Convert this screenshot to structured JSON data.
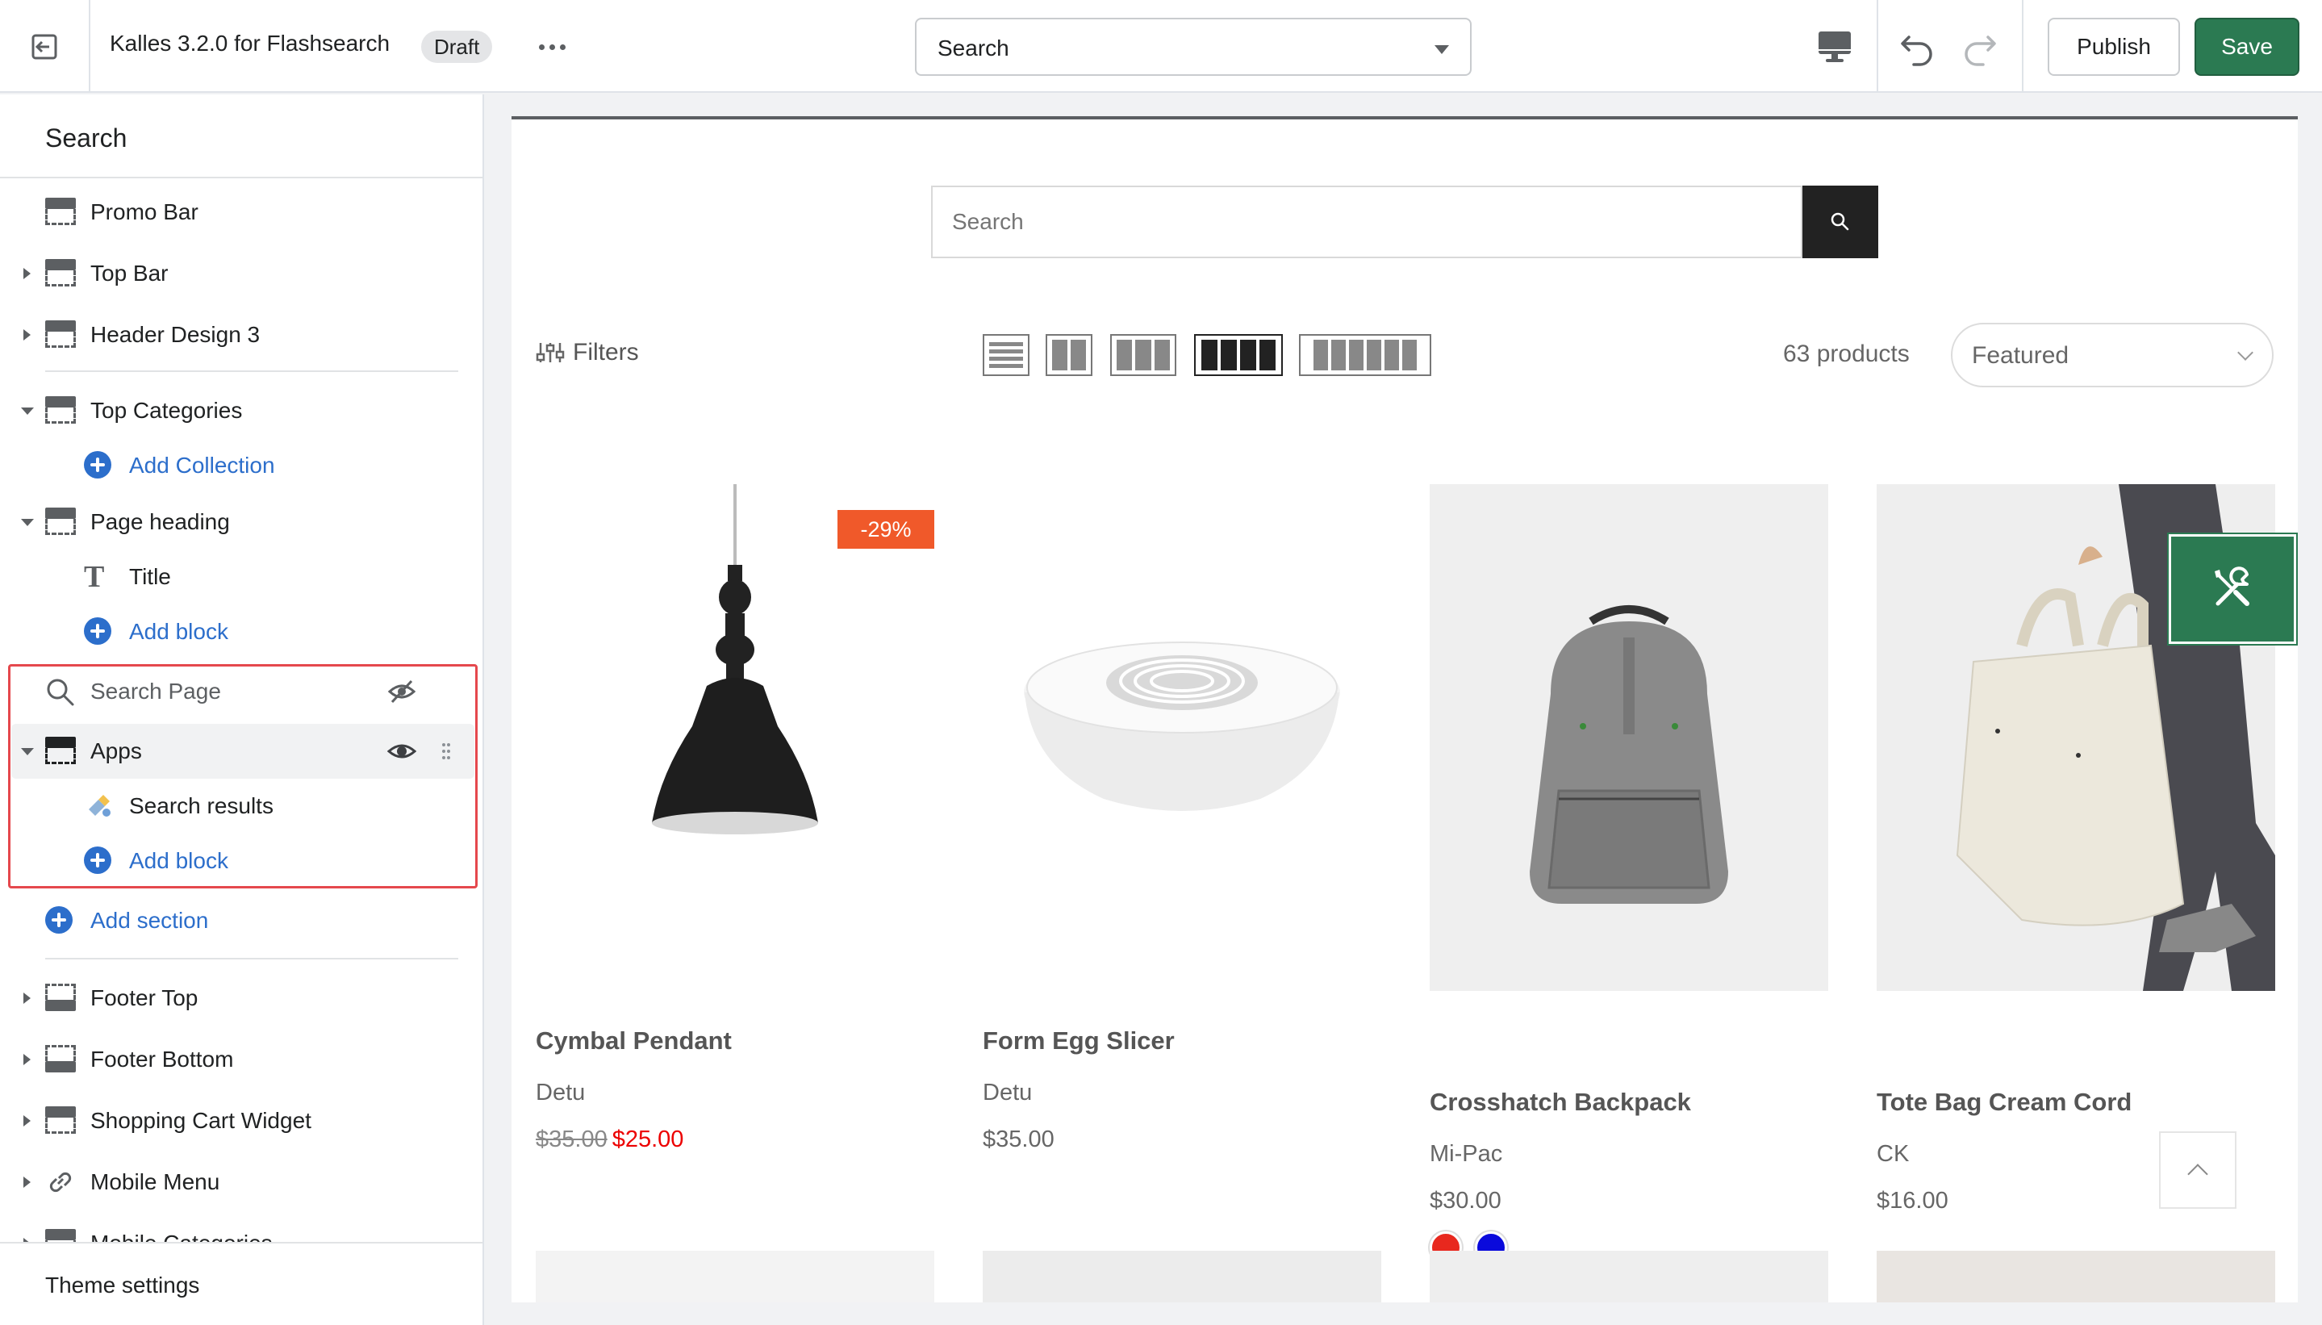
{
  "topbar": {
    "title": "Kalles 3.2.0 for Flashsearch",
    "badge": "Draft",
    "template_select": "Search",
    "publish_label": "Publish",
    "save_label": "Save"
  },
  "sidebar": {
    "header": "Search",
    "items": {
      "promo_bar": "Promo Bar",
      "top_bar": "Top Bar",
      "header_design": "Header Design 3",
      "top_categories": "Top Categories",
      "add_collection": "Add Collection",
      "page_heading": "Page heading",
      "title": "Title",
      "add_block_1": "Add block",
      "search_page": "Search Page",
      "apps": "Apps",
      "search_results": "Search results",
      "add_block_2": "Add block",
      "add_section": "Add section",
      "footer_top": "Footer Top",
      "footer_bottom": "Footer Bottom",
      "shopping_cart": "Shopping Cart Widget",
      "mobile_menu": "Mobile Menu",
      "mobile_categories": "Mobile Categories"
    },
    "footer": "Theme settings"
  },
  "preview": {
    "search_placeholder": "Search",
    "filters_label": "Filters",
    "product_count": "63 products",
    "sort_selected": "Featured",
    "products": [
      {
        "name": "Cymbal Pendant",
        "vendor": "Detu",
        "compare_price": "$35.00",
        "price": "$25.00",
        "badge": "-29%"
      },
      {
        "name": "Form Egg Slicer",
        "vendor": "Detu",
        "price": "$35.00"
      },
      {
        "name": "Crosshatch Backpack",
        "vendor": "Mi-Pac",
        "price": "$30.00",
        "swatches": [
          "#e8281e",
          "#0a0adc"
        ]
      },
      {
        "name": "Tote Bag Cream Cord",
        "vendor": "CK",
        "price": "$16.00"
      }
    ]
  },
  "colors": {
    "accent": "#2b7a52",
    "link": "#2c6ecb",
    "sale": "#ec0101",
    "badge": "#f0592a",
    "highlight": "#e5484d"
  }
}
